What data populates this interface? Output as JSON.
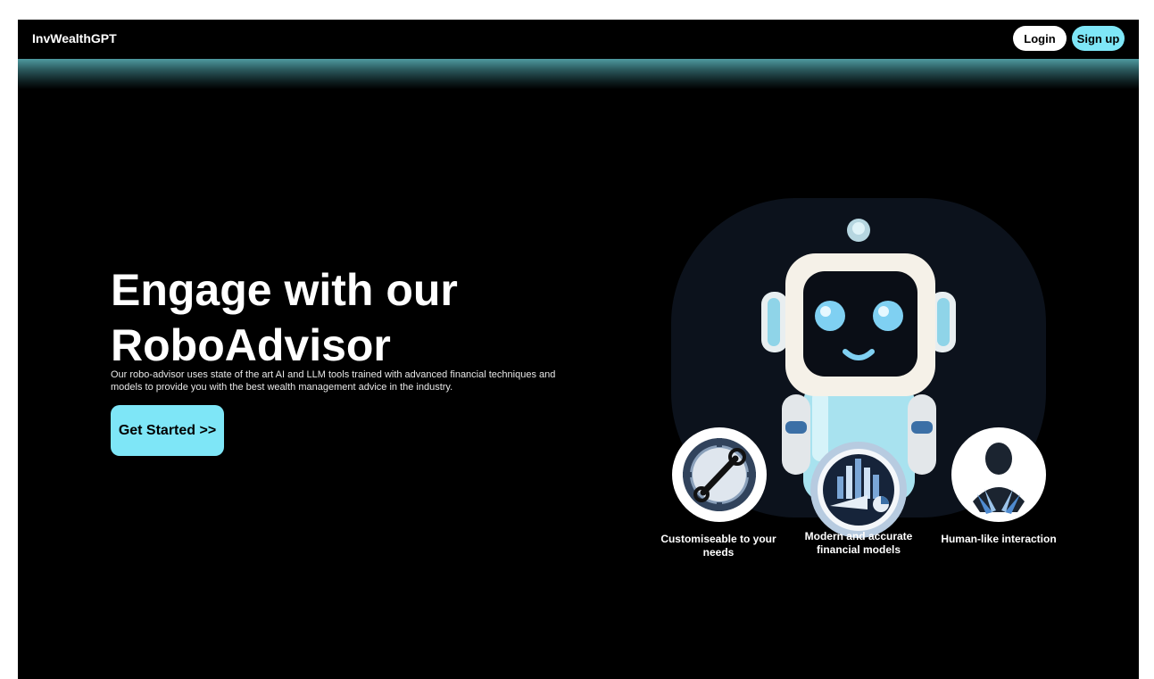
{
  "nav": {
    "brand": "InvWealthGPT",
    "login_label": "Login",
    "signup_label": "Sign up"
  },
  "hero": {
    "title": "Engage with our RoboAdvisor",
    "description": "Our robo-advisor uses state of the art AI and LLM tools trained with advanced financial techniques and models to provide you with the best wealth management advice in the industry.",
    "cta_label": "Get Started >>"
  },
  "features": [
    {
      "label": "Customiseable to your needs",
      "icon": "gear-wrench-icon"
    },
    {
      "label": "Modern and accurate financial models",
      "icon": "financial-chart-icon"
    },
    {
      "label": "Human-like interaction",
      "icon": "person-icon"
    }
  ],
  "colors": {
    "accent": "#7ee6f7",
    "background": "#000000",
    "text": "#ffffff"
  }
}
